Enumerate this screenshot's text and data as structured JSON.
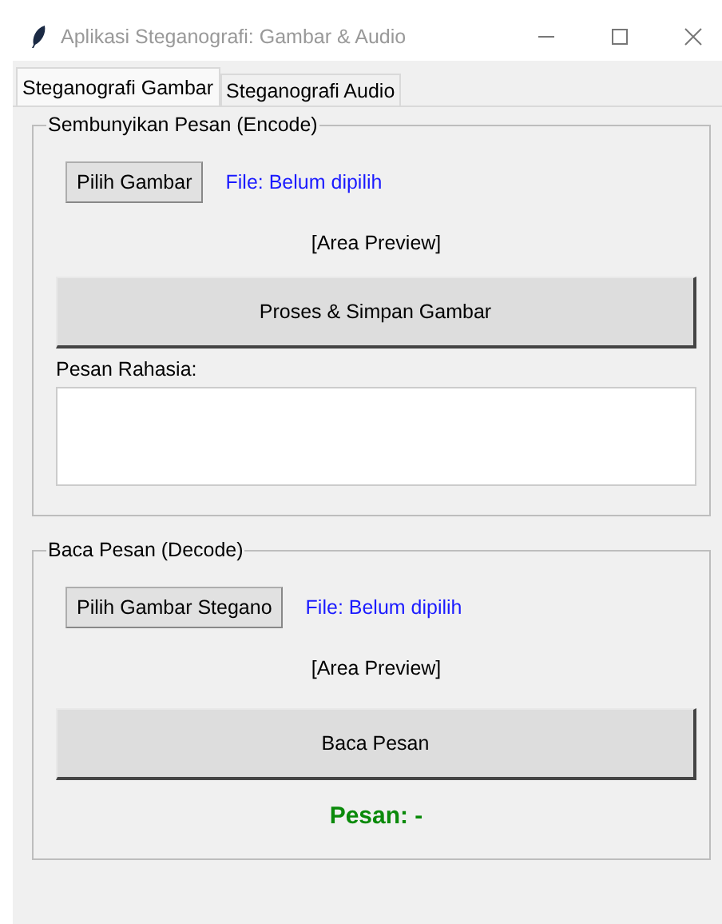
{
  "window": {
    "title": "Aplikasi Steganografi: Gambar & Audio"
  },
  "tabs": [
    {
      "label": "Steganografi Gambar",
      "selected": true
    },
    {
      "label": "Steganografi Audio",
      "selected": false
    }
  ],
  "encode": {
    "legend": "Sembunyikan Pesan (Encode)",
    "choose_button": "Pilih Gambar",
    "file_label": "File: Belum dipilih",
    "preview": "[Area Preview]",
    "process_button": "Proses & Simpan Gambar",
    "message_label": "Pesan Rahasia:"
  },
  "decode": {
    "legend": "Baca Pesan (Decode)",
    "choose_button": "Pilih Gambar Stegano",
    "file_label": "File: Belum dipilih",
    "preview": "[Area Preview]",
    "read_button": "Baca Pesan",
    "result": "Pesan: -"
  }
}
